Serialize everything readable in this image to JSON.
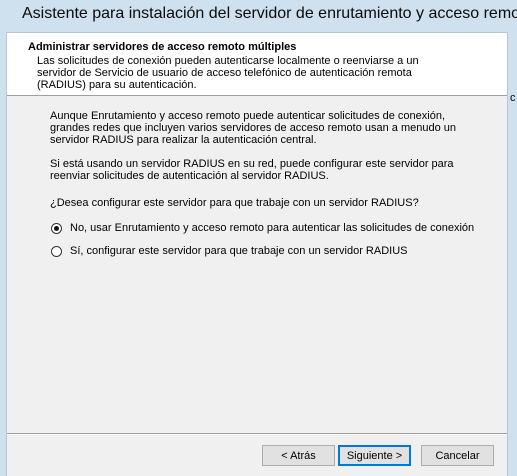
{
  "window": {
    "title": "Asistente para instalación del servidor de enrutamiento y acceso remoto",
    "background_fragment": "c"
  },
  "header": {
    "title": "Administrar servidores de acceso remoto múltiples",
    "description": "Las solicitudes de conexión pueden autenticarse localmente o reenviarse a un servidor de Servicio de usuario de acceso telefónico de autenticación remota (RADIUS) para su autenticación."
  },
  "body": {
    "paragraph1": "Aunque Enrutamiento y acceso remoto puede autenticar solicitudes de conexión, grandes redes que incluyen varios servidores de acceso remoto usan a menudo un servidor RADIUS para realizar la autenticación central.",
    "paragraph2": "Si está usando un servidor RADIUS en su red, puede configurar este servidor para reenviar solicitudes de autenticación al servidor RADIUS.",
    "question": "¿Desea configurar este servidor para que trabaje con un servidor RADIUS?",
    "options": [
      {
        "label": "No, usar Enrutamiento y acceso remoto para autenticar las solicitudes de conexión",
        "selected": true
      },
      {
        "label": "Sí, configurar este servidor para que trabaje con un servidor RADIUS",
        "selected": false
      }
    ]
  },
  "buttons": {
    "back": "< Atrás",
    "next": "Siguiente >",
    "cancel": "Cancelar"
  }
}
